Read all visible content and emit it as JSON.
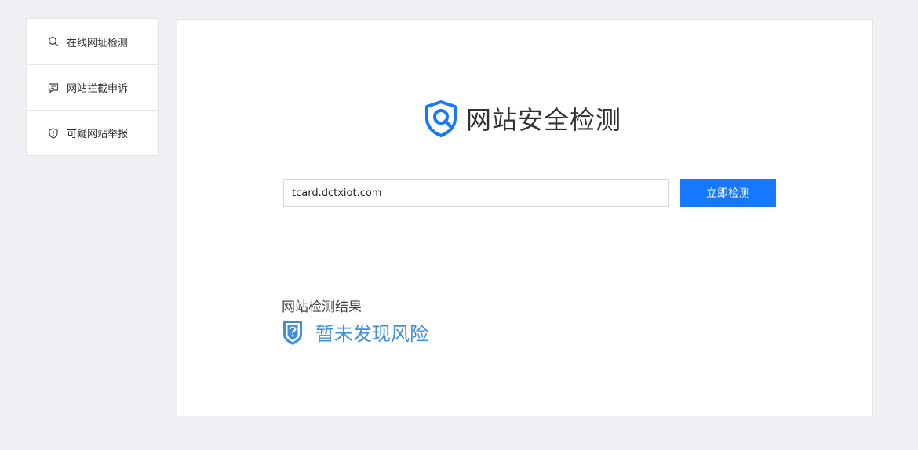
{
  "sidebar": {
    "items": [
      {
        "label": "在线网址检测",
        "icon": "search-icon"
      },
      {
        "label": "网站拦截申诉",
        "icon": "message-icon"
      },
      {
        "label": "可疑网站举报",
        "icon": "shield-alert-icon"
      }
    ]
  },
  "brand": {
    "title": "网站安全检测",
    "logo_icon": "shield-search-icon",
    "accent_color": "#1677ff"
  },
  "search": {
    "value": "tcard.dctxiot.com",
    "button_label": "立即检测"
  },
  "result": {
    "heading": "网站检测结果",
    "status": "暂未发现风险",
    "status_icon": "shield-question-icon",
    "status_color": "#3f8ee0"
  }
}
